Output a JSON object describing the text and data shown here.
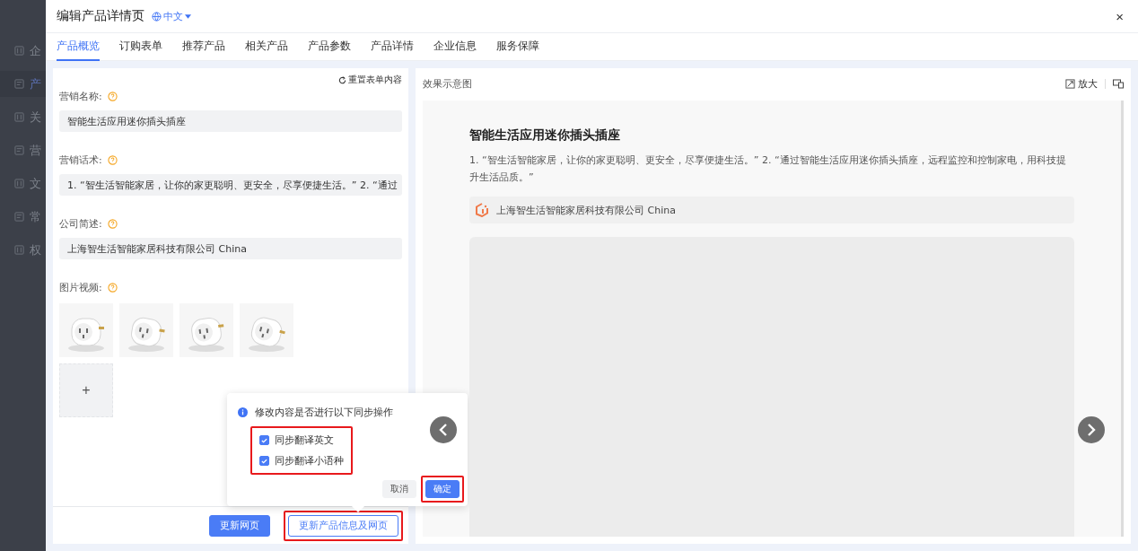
{
  "sidebar": {
    "items": [
      {
        "label": "企",
        "selected": false
      },
      {
        "label": "产",
        "selected": true
      },
      {
        "label": "关",
        "selected": false
      },
      {
        "label": "营",
        "selected": false
      },
      {
        "label": "文",
        "selected": false
      },
      {
        "label": "常",
        "selected": false
      },
      {
        "label": "权",
        "selected": false
      }
    ]
  },
  "window": {
    "title": "编辑产品详情页",
    "language": "中文",
    "close": "×"
  },
  "tabs": [
    {
      "label": "产品概览",
      "selected": true
    },
    {
      "label": "订购表单",
      "selected": false
    },
    {
      "label": "推荐产品",
      "selected": false
    },
    {
      "label": "相关产品",
      "selected": false
    },
    {
      "label": "产品参数",
      "selected": false
    },
    {
      "label": "产品详情",
      "selected": false
    },
    {
      "label": "企业信息",
      "selected": false
    },
    {
      "label": "服务保障",
      "selected": false
    }
  ],
  "form": {
    "reset": "重置表单内容",
    "fields": [
      {
        "label": "营销名称:",
        "value": "智能生活应用迷你插头插座"
      },
      {
        "label": "营销话术:",
        "value": "1. “智生活智能家居，让你的家更聪明、更安全，尽享便捷生活。” 2. “通过"
      },
      {
        "label": "公司简述:",
        "value": "上海智生活智能家居科技有限公司 China"
      }
    ],
    "media": {
      "label": "图片视频:",
      "add": "+"
    },
    "buttons": [
      {
        "label": "更新网页",
        "kind": "primary",
        "highlighted": false
      },
      {
        "label": "更新产品信息及网页",
        "kind": "outline",
        "highlighted": true
      }
    ]
  },
  "popover": {
    "message": "修改内容是否进行以下同步操作",
    "options_highlighted": true,
    "options": [
      {
        "label": "同步翻译英文",
        "checked": true
      },
      {
        "label": "同步翻译小语种",
        "checked": true
      }
    ],
    "buttons": [
      {
        "label": "取消",
        "kind": "default",
        "highlighted": false
      },
      {
        "label": "确定",
        "kind": "primary",
        "highlighted": true
      }
    ]
  },
  "preview": {
    "title": "效果示意图",
    "zoom": "放大",
    "product_title": "智能生活应用迷你插头插座",
    "description": "1. “智生活智能家居，让你的家更聪明、更安全，尽享便捷生活。” 2. “通过智能生活应用迷你插头插座，远程监控和控制家电，用科技提升生活品质。”",
    "company": "上海智生活智能家居科技有限公司 China"
  }
}
